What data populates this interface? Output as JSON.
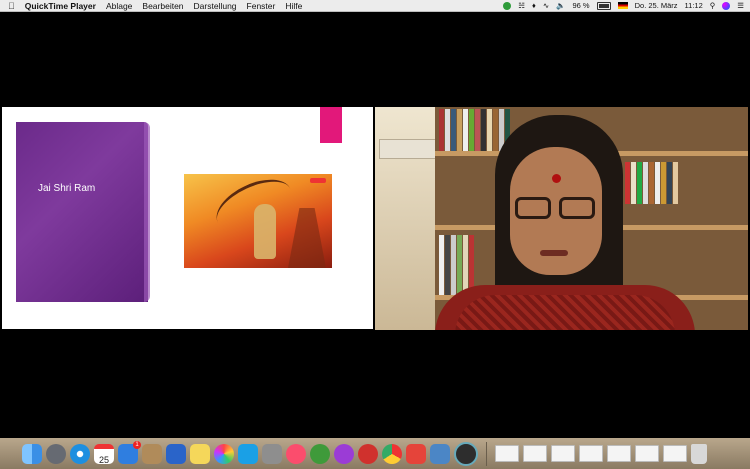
{
  "menubar": {
    "app_name": "QuickTime Player",
    "menu_items": [
      "Ablage",
      "Bearbeiten",
      "Darstellung",
      "Fenster",
      "Hilfe"
    ],
    "battery_percent": "96 %",
    "date": "Do. 25. März",
    "time": "11:12"
  },
  "slide": {
    "title": "Jai Shri Ram"
  },
  "dock": {
    "calendar_day": "25",
    "appstore_badge": "1",
    "colors": {
      "finder": "#3a8fe6",
      "launchpad": "#666a72",
      "safari": "#1e8fe0",
      "calendar": "#ffffff",
      "appstore": "#2f7ee0",
      "contacts": "#b08b5a",
      "word": "#2a64c9",
      "notes": "#f5d75a",
      "photos": "#ffffff",
      "skype": "#1aa0e6",
      "prefs": "#8e8e8e",
      "music": "#fb4d6d",
      "vlc": "#3f9a3a",
      "podcasts": "#9b3cd6",
      "express": "#d0312d",
      "chrome": "#ffffff",
      "pdf": "#e5443a",
      "preview": "#4b86c6",
      "quicktime": "#2d2d2d",
      "trash": "#d8d8d8"
    }
  }
}
